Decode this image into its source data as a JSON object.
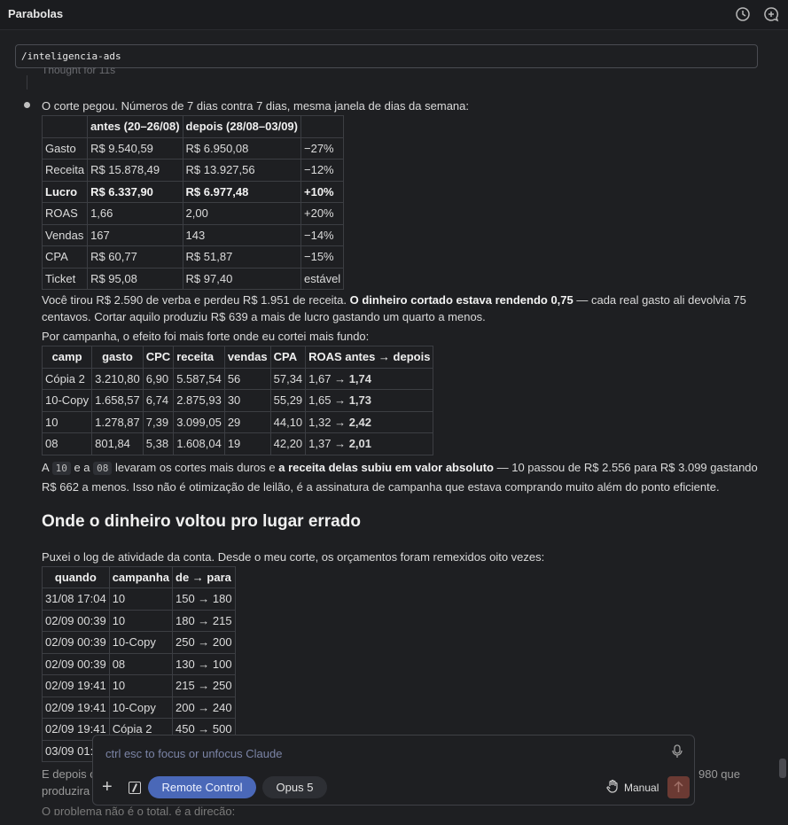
{
  "header": {
    "title": "Parabolas",
    "history_icon": "clock-icon",
    "new_chat_icon": "chat-plus-icon"
  },
  "command": {
    "text": "/inteligencia-ads"
  },
  "thought": {
    "label": "Thought for 11s"
  },
  "intro": "O corte pegou. Números de 7 dias contra 7 dias, mesma janela de dias da semana:",
  "table1": {
    "headers": [
      "",
      "antes (20–26/08)",
      "depois (28/08–03/09)",
      ""
    ],
    "rows": [
      [
        "Gasto",
        "R$ 9.540,59",
        "R$ 6.950,08",
        "−27%"
      ],
      [
        "Receita",
        "R$ 15.878,49",
        "R$ 13.927,56",
        "−12%"
      ],
      [
        "Lucro",
        "R$ 6.337,90",
        "R$ 6.977,48",
        "+10%"
      ],
      [
        "ROAS",
        "1,66",
        "2,00",
        "+20%"
      ],
      [
        "Vendas",
        "167",
        "143",
        "−14%"
      ],
      [
        "CPA",
        "R$ 60,77",
        "R$ 51,87",
        "−15%"
      ],
      [
        "Ticket",
        "R$ 95,08",
        "R$ 97,40",
        "estável"
      ]
    ]
  },
  "para1": {
    "a": "Você tirou R$ 2.590 de verba e perdeu R$ 1.951 de receita. ",
    "b": "O dinheiro cortado estava rendendo 0,75",
    "c": " — cada real gasto ali devolvia 75 centavos. Cortar aquilo produziu R$ 639 a mais de lucro gastando um quarto a menos."
  },
  "para2": "Por campanha, o efeito foi mais forte onde eu cortei mais fundo:",
  "table2": {
    "headers": [
      "camp",
      "gasto",
      "CPC",
      "receita",
      "vendas",
      "CPA",
      "ROAS antes → depois"
    ],
    "rows": [
      [
        "Cópia 2",
        "3.210,80",
        "6,90",
        "5.587,54",
        "56",
        "57,34",
        "1,67 → ",
        "1,74"
      ],
      [
        "10-Copy",
        "1.658,57",
        "6,74",
        "2.875,93",
        "30",
        "55,29",
        "1,65 → ",
        "1,73"
      ],
      [
        "10",
        "1.278,87",
        "7,39",
        "3.099,05",
        "29",
        "44,10",
        "1,32 → ",
        "2,42"
      ],
      [
        "08",
        "801,84",
        "5,38",
        "1.608,04",
        "19",
        "42,20",
        "1,37 → ",
        "2,01"
      ]
    ]
  },
  "para3": {
    "a": "A ",
    "chip1": "10",
    "b": " e a ",
    "chip2": "08",
    "c": " levaram os cortes mais duros e ",
    "d": "a receita delas subiu em valor absoluto",
    "e": " — 10 passou de R$ 2.556 para R$ 3.099 gastando R$ 662 a menos. Isso não é otimização de leilão, é a assinatura de campanha que estava comprando muito além do ponto eficiente."
  },
  "heading": "Onde o dinheiro voltou pro lugar errado",
  "para4": "Puxei o log de atividade da conta. Desde o meu corte, os orçamentos foram remexidos oito vezes:",
  "table3": {
    "headers": [
      "quando",
      "campanha",
      "de → para"
    ],
    "rows": [
      [
        "31/08 17:04",
        "10",
        "150 → 180"
      ],
      [
        "02/09 00:39",
        "10",
        "180 → 215"
      ],
      [
        "02/09 00:39",
        "10-Copy",
        "250 → 200"
      ],
      [
        "02/09 00:39",
        "08",
        "130 → 100"
      ],
      [
        "02/09 19:41",
        "10",
        "215 → 250"
      ],
      [
        "02/09 19:41",
        "10-Copy",
        "200 → 240"
      ],
      [
        "02/09 19:41",
        "Cópia 2",
        "450 → 500"
      ],
      [
        "03/09 01:",
        "",
        ""
      ]
    ]
  },
  "para5_left": "E depois o",
  "para5_left2": "produzira",
  "para5_right": "980 que",
  "para6": "O problema não é o total, é a direção:",
  "input": {
    "placeholder": "ctrl esc to focus or unfocus Claude",
    "remote_label": "Remote Control",
    "model_label": "Opus 5",
    "mode_label": "Manual"
  }
}
